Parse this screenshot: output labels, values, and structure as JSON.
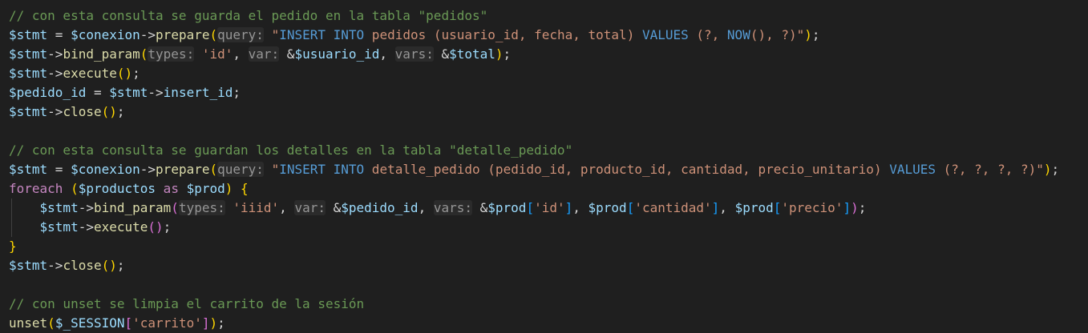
{
  "editor": {
    "lines": [
      {
        "tokens": [
          {
            "t": "// con esta consulta se guarda el pedido en la tabla \"pedidos\"",
            "c": "comment"
          }
        ]
      },
      {
        "tokens": [
          {
            "t": "$stmt",
            "c": "var"
          },
          {
            "t": " = ",
            "c": "op"
          },
          {
            "t": "$conexion",
            "c": "var"
          },
          {
            "t": "->",
            "c": "op"
          },
          {
            "t": "prepare",
            "c": "func"
          },
          {
            "t": "(",
            "c": "brace"
          },
          {
            "t": "query:",
            "c": "hint"
          },
          {
            "t": " ",
            "c": "punc"
          },
          {
            "t": "\"",
            "c": "str"
          },
          {
            "t": "INSERT INTO",
            "c": "sqlkw"
          },
          {
            "t": " pedidos (usuario_id, fecha, total) ",
            "c": "str"
          },
          {
            "t": "VALUES",
            "c": "sqlkw"
          },
          {
            "t": " (?, ",
            "c": "str"
          },
          {
            "t": "NOW",
            "c": "sqlkw"
          },
          {
            "t": "()",
            "c": "str"
          },
          {
            "t": ", ?)\"",
            "c": "str"
          },
          {
            "t": ")",
            "c": "brace"
          },
          {
            "t": ";",
            "c": "punc"
          }
        ]
      },
      {
        "tokens": [
          {
            "t": "$stmt",
            "c": "var"
          },
          {
            "t": "->",
            "c": "op"
          },
          {
            "t": "bind_param",
            "c": "func"
          },
          {
            "t": "(",
            "c": "brace"
          },
          {
            "t": "types:",
            "c": "hint"
          },
          {
            "t": " ",
            "c": "punc"
          },
          {
            "t": "'id'",
            "c": "str"
          },
          {
            "t": ", ",
            "c": "punc"
          },
          {
            "t": "var:",
            "c": "hint"
          },
          {
            "t": " &",
            "c": "op"
          },
          {
            "t": "$usuario_id",
            "c": "var"
          },
          {
            "t": ", ",
            "c": "punc"
          },
          {
            "t": "vars:",
            "c": "hint"
          },
          {
            "t": " &",
            "c": "op"
          },
          {
            "t": "$total",
            "c": "var"
          },
          {
            "t": ")",
            "c": "brace"
          },
          {
            "t": ";",
            "c": "punc"
          }
        ]
      },
      {
        "tokens": [
          {
            "t": "$stmt",
            "c": "var"
          },
          {
            "t": "->",
            "c": "op"
          },
          {
            "t": "execute",
            "c": "func"
          },
          {
            "t": "()",
            "c": "brace"
          },
          {
            "t": ";",
            "c": "punc"
          }
        ]
      },
      {
        "tokens": [
          {
            "t": "$pedido_id",
            "c": "var"
          },
          {
            "t": " = ",
            "c": "op"
          },
          {
            "t": "$stmt",
            "c": "var"
          },
          {
            "t": "->",
            "c": "op"
          },
          {
            "t": "insert_id",
            "c": "var"
          },
          {
            "t": ";",
            "c": "punc"
          }
        ]
      },
      {
        "tokens": [
          {
            "t": "$stmt",
            "c": "var"
          },
          {
            "t": "->",
            "c": "op"
          },
          {
            "t": "close",
            "c": "func"
          },
          {
            "t": "()",
            "c": "brace"
          },
          {
            "t": ";",
            "c": "punc"
          }
        ]
      },
      {
        "tokens": []
      },
      {
        "tokens": [
          {
            "t": "// con esta consulta se guardan los detalles en la tabla \"detalle_pedido\"",
            "c": "comment"
          }
        ]
      },
      {
        "tokens": [
          {
            "t": "$stmt",
            "c": "var"
          },
          {
            "t": " = ",
            "c": "op"
          },
          {
            "t": "$conexion",
            "c": "var"
          },
          {
            "t": "->",
            "c": "op"
          },
          {
            "t": "prepare",
            "c": "func"
          },
          {
            "t": "(",
            "c": "brace"
          },
          {
            "t": "query:",
            "c": "hint"
          },
          {
            "t": " ",
            "c": "punc"
          },
          {
            "t": "\"",
            "c": "str"
          },
          {
            "t": "INSERT INTO",
            "c": "sqlkw"
          },
          {
            "t": " detalle_pedido (pedido_id, producto_id, cantidad, precio_unitario) ",
            "c": "str"
          },
          {
            "t": "VALUES",
            "c": "sqlkw"
          },
          {
            "t": " (?, ?, ?, ?)\"",
            "c": "str"
          },
          {
            "t": ")",
            "c": "brace"
          },
          {
            "t": ";",
            "c": "punc"
          }
        ]
      },
      {
        "tokens": [
          {
            "t": "foreach",
            "c": "ctrl"
          },
          {
            "t": " ",
            "c": "punc"
          },
          {
            "t": "(",
            "c": "brace"
          },
          {
            "t": "$productos",
            "c": "var"
          },
          {
            "t": " as ",
            "c": "ctrl"
          },
          {
            "t": "$prod",
            "c": "var"
          },
          {
            "t": ")",
            "c": "brace"
          },
          {
            "t": " ",
            "c": "punc"
          },
          {
            "t": "{",
            "c": "brace"
          }
        ]
      },
      {
        "guide": true,
        "tokens": [
          {
            "t": "    ",
            "c": "punc"
          },
          {
            "t": "$stmt",
            "c": "var"
          },
          {
            "t": "->",
            "c": "op"
          },
          {
            "t": "bind_param",
            "c": "func"
          },
          {
            "t": "(",
            "c": "paren1"
          },
          {
            "t": "types:",
            "c": "hint"
          },
          {
            "t": " ",
            "c": "punc"
          },
          {
            "t": "'iiid'",
            "c": "str"
          },
          {
            "t": ", ",
            "c": "punc"
          },
          {
            "t": "var:",
            "c": "hint"
          },
          {
            "t": " &",
            "c": "op"
          },
          {
            "t": "$pedido_id",
            "c": "var"
          },
          {
            "t": ", ",
            "c": "punc"
          },
          {
            "t": "vars:",
            "c": "hint"
          },
          {
            "t": " &",
            "c": "op"
          },
          {
            "t": "$prod",
            "c": "var"
          },
          {
            "t": "[",
            "c": "paren2"
          },
          {
            "t": "'id'",
            "c": "str"
          },
          {
            "t": "]",
            "c": "paren2"
          },
          {
            "t": ", ",
            "c": "punc"
          },
          {
            "t": "$prod",
            "c": "var"
          },
          {
            "t": "[",
            "c": "paren2"
          },
          {
            "t": "'cantidad'",
            "c": "str"
          },
          {
            "t": "]",
            "c": "paren2"
          },
          {
            "t": ", ",
            "c": "punc"
          },
          {
            "t": "$prod",
            "c": "var"
          },
          {
            "t": "[",
            "c": "paren2"
          },
          {
            "t": "'precio'",
            "c": "str"
          },
          {
            "t": "]",
            "c": "paren2"
          },
          {
            "t": ")",
            "c": "paren1"
          },
          {
            "t": ";",
            "c": "punc"
          }
        ]
      },
      {
        "guide": true,
        "tokens": [
          {
            "t": "    ",
            "c": "punc"
          },
          {
            "t": "$stmt",
            "c": "var"
          },
          {
            "t": "->",
            "c": "op"
          },
          {
            "t": "execute",
            "c": "func"
          },
          {
            "t": "()",
            "c": "paren1"
          },
          {
            "t": ";",
            "c": "punc"
          }
        ]
      },
      {
        "tokens": [
          {
            "t": "}",
            "c": "brace"
          }
        ]
      },
      {
        "tokens": [
          {
            "t": "$stmt",
            "c": "var"
          },
          {
            "t": "->",
            "c": "op"
          },
          {
            "t": "close",
            "c": "func"
          },
          {
            "t": "()",
            "c": "brace"
          },
          {
            "t": ";",
            "c": "punc"
          }
        ]
      },
      {
        "tokens": []
      },
      {
        "tokens": [
          {
            "t": "// con unset se limpia el carrito de la sesión",
            "c": "comment"
          }
        ]
      },
      {
        "tokens": [
          {
            "t": "unset",
            "c": "func"
          },
          {
            "t": "(",
            "c": "brace"
          },
          {
            "t": "$_SESSION",
            "c": "var"
          },
          {
            "t": "[",
            "c": "paren1"
          },
          {
            "t": "'carrito'",
            "c": "str"
          },
          {
            "t": "]",
            "c": "paren1"
          },
          {
            "t": ")",
            "c": "brace"
          },
          {
            "t": ";",
            "c": "punc"
          }
        ]
      }
    ]
  }
}
